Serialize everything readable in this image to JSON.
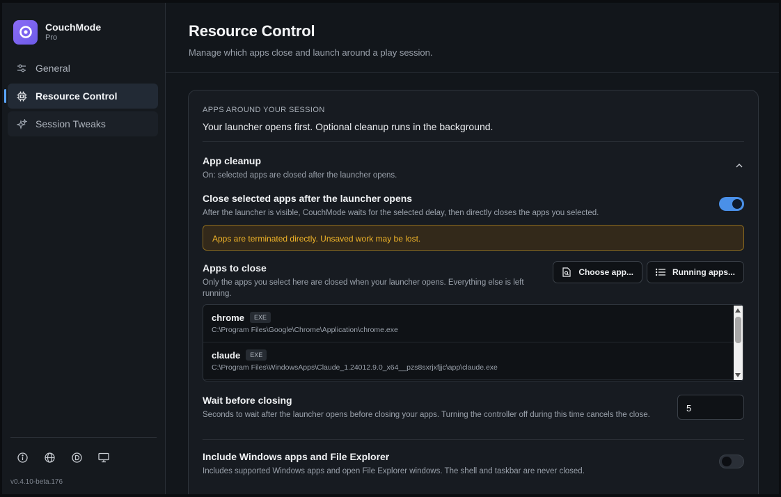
{
  "brand": {
    "name": "CouchMode",
    "tier": "Pro",
    "logo_icon": "couchmode-logo-icon",
    "color": "#7c63f0"
  },
  "sidebar": {
    "items": [
      {
        "label": "General",
        "icon": "sliders-icon",
        "active": false
      },
      {
        "label": "Resource Control",
        "icon": "chip-icon",
        "active": true
      },
      {
        "label": "Session Tweaks",
        "icon": "sparkles-icon",
        "active": false
      }
    ],
    "footer_icons": [
      "info-icon",
      "globe-icon",
      "discord-icon",
      "monitor-icon"
    ],
    "version": "v0.4.10-beta.176"
  },
  "header": {
    "title": "Resource Control",
    "subtitle": "Manage which apps close and launch around a play session."
  },
  "section": {
    "kicker": "APPS AROUND YOUR SESSION",
    "description": "Your launcher opens first. Optional cleanup runs in the background."
  },
  "cleanup": {
    "title": "App cleanup",
    "description": "On: selected apps are closed after the launcher opens.",
    "expanded": true
  },
  "close_after_launch": {
    "title": "Close selected apps after the launcher opens",
    "description": "After the launcher is visible, CouchMode waits for the selected delay, then directly closes the apps you selected.",
    "enabled": true
  },
  "warning": {
    "text": "Apps are terminated directly. Unsaved work may be lost.",
    "color": "#f0b429"
  },
  "apps_to_close": {
    "title": "Apps to close",
    "description": "Only the apps you select here are closed when your launcher opens. Everything else is left running.",
    "choose_button": "Choose app...",
    "running_button": "Running apps...",
    "apps": [
      {
        "name": "chrome",
        "badge": "EXE",
        "path": "C:\\Program Files\\Google\\Chrome\\Application\\chrome.exe"
      },
      {
        "name": "claude",
        "badge": "EXE",
        "path": "C:\\Program Files\\WindowsApps\\Claude_1.24012.9.0_x64__pzs8sxrjxfjjc\\app\\claude.exe"
      }
    ]
  },
  "wait": {
    "title": "Wait before closing",
    "description": "Seconds to wait after the launcher opens before closing your apps. Turning the controller off during this time cancels the close.",
    "value": "5"
  },
  "windows_apps": {
    "title": "Include Windows apps and File Explorer",
    "description": "Includes supported Windows apps and open File Explorer windows. The shell and taskbar are never closed.",
    "enabled": false
  },
  "accent_color": "#4a90e8"
}
